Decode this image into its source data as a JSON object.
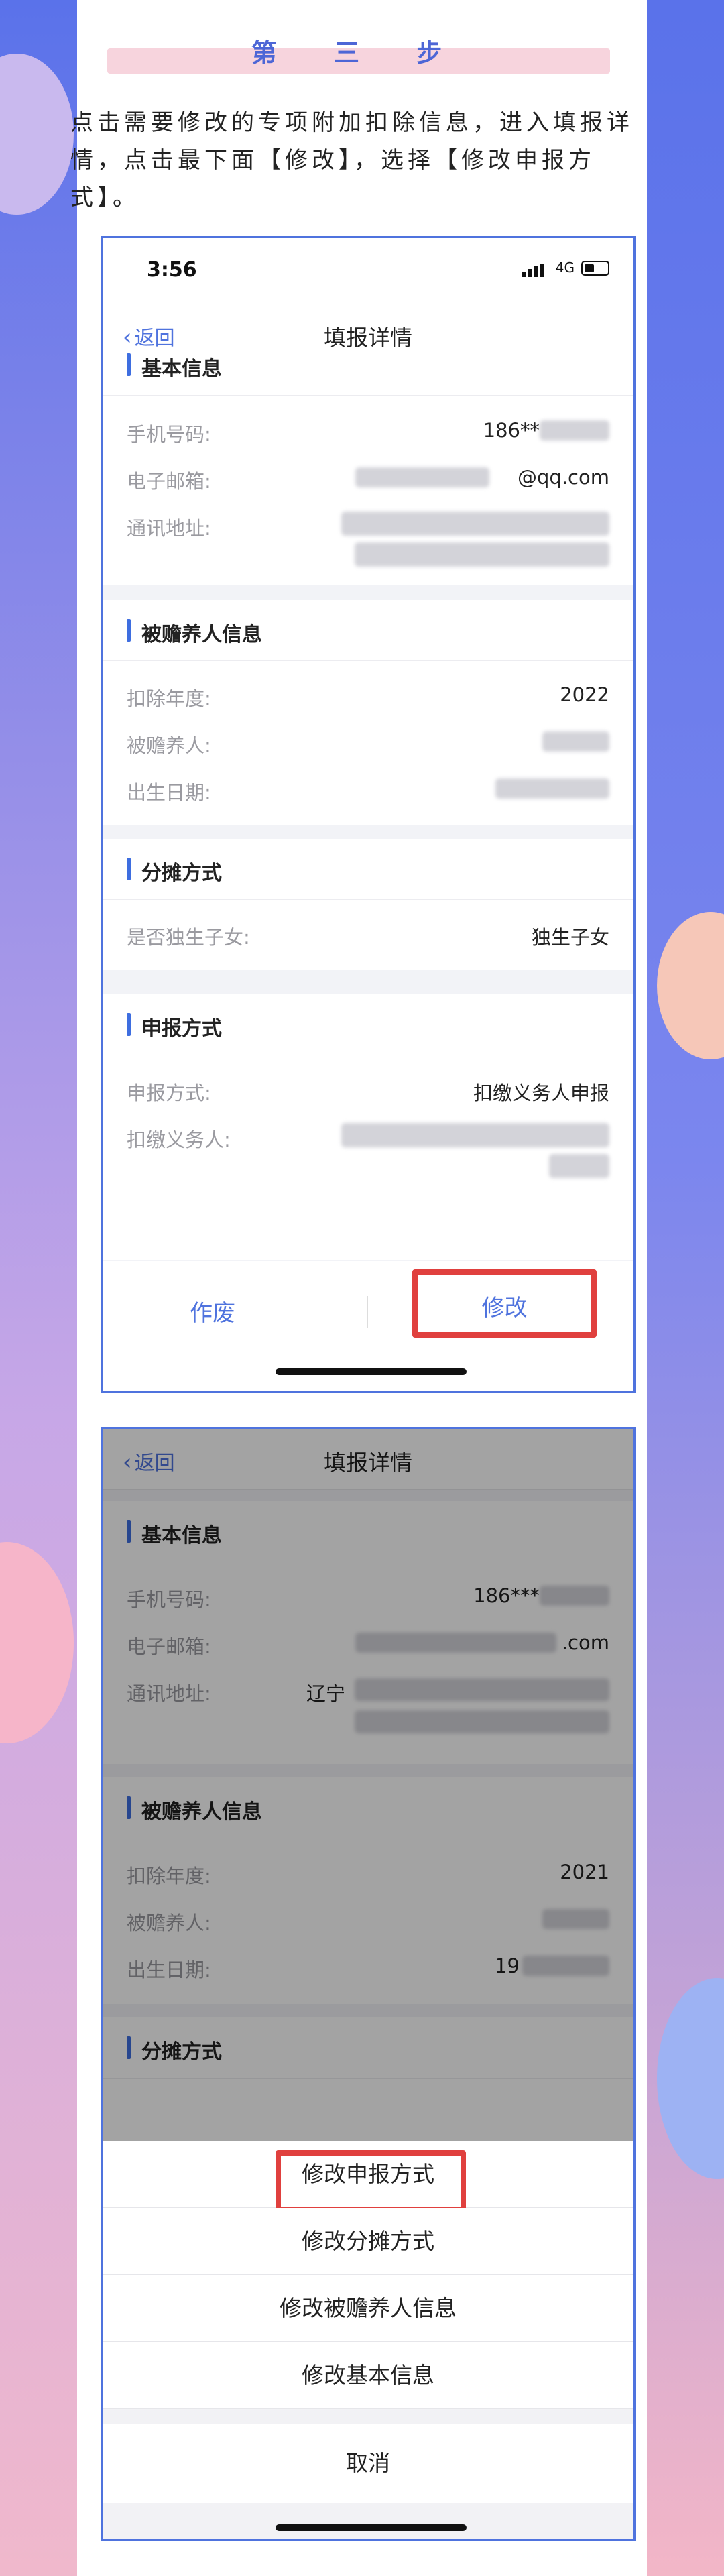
{
  "step_title": "第 三 步",
  "intro_text": "点击需要修改的专项附加扣除信息，进入填报详情，点击最下面【修改】，选择【修改申报方式】。",
  "phone1": {
    "status": {
      "time": "3:56",
      "network": "4G"
    },
    "nav": {
      "back": "返回",
      "title": "填报详情"
    },
    "sections": {
      "basic": {
        "title": "基本信息",
        "phone_label": "手机号码:",
        "phone_value": "186**",
        "email_label": "电子邮箱:",
        "email_value": "@qq.com",
        "address_label": "通讯地址:"
      },
      "dependent": {
        "title": "被赡养人信息",
        "year_label": "扣除年度:",
        "year_value": "2022",
        "person_label": "被赡养人:",
        "birth_label": "出生日期:"
      },
      "share": {
        "title": "分摊方式",
        "only_child_label": "是否独生子女:",
        "only_child_value": "独生子女"
      },
      "declare": {
        "title": "申报方式",
        "method_label": "申报方式:",
        "method_value": "扣缴义务人申报",
        "agent_label": "扣缴义务人:"
      }
    },
    "bottom": {
      "void_label": "作废",
      "edit_label": "修改"
    }
  },
  "phone2": {
    "nav": {
      "back": "返回",
      "title": "填报详情"
    },
    "sections": {
      "basic": {
        "title": "基本信息",
        "phone_label": "手机号码:",
        "phone_value": "186***",
        "email_label": "电子邮箱:",
        "email_value": ".com",
        "address_label": "通讯地址:",
        "address_value": "辽宁"
      },
      "dependent": {
        "title": "被赡养人信息",
        "year_label": "扣除年度:",
        "year_value": "2021",
        "person_label": "被赡养人:",
        "birth_label": "出生日期:",
        "birth_value": "19"
      },
      "share": {
        "title": "分摊方式"
      }
    },
    "sheet": {
      "items": [
        "修改申报方式",
        "修改分摊方式",
        "修改被赡养人信息",
        "修改基本信息"
      ],
      "cancel": "取消"
    }
  }
}
